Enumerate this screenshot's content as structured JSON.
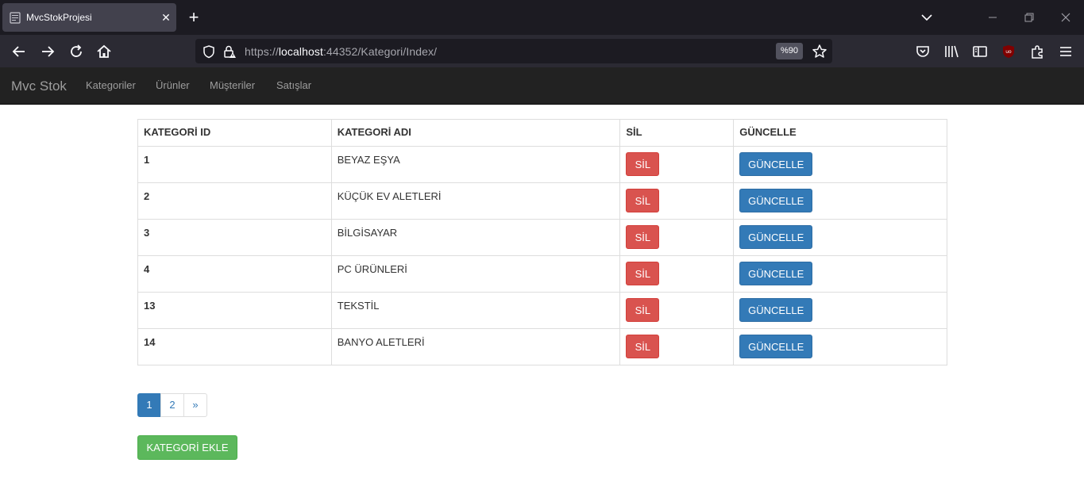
{
  "browser": {
    "tab_title": "MvcStokProjesi",
    "tab_close": "✕",
    "new_tab": "+",
    "url_prefix": "https://",
    "url_host": "localhost",
    "url_rest": ":44352/Kategori/Index/",
    "zoom": "%90",
    "icons": [
      "back-icon",
      "forward-icon",
      "reload-icon",
      "home-icon",
      "shield-icon",
      "lock-icon",
      "star-icon",
      "pocket-icon",
      "library-icon",
      "sidebar-icon",
      "ublock-icon",
      "extensions-icon",
      "menu-icon"
    ]
  },
  "site_nav": {
    "brand": "Mvc Stok",
    "links": [
      "Kategoriler",
      "Ürünler",
      "Müşteriler",
      "Satışlar"
    ]
  },
  "table": {
    "headers": [
      "KATEGORİ ID",
      "KATEGORİ ADI",
      "SİL",
      "GÜNCELLE"
    ],
    "rows": [
      {
        "id": "1",
        "name": "BEYAZ EŞYA"
      },
      {
        "id": "2",
        "name": "KÜÇÜK EV ALETLERİ"
      },
      {
        "id": "3",
        "name": "BİLGİSAYAR"
      },
      {
        "id": "4",
        "name": "PC ÜRÜNLERİ"
      },
      {
        "id": "13",
        "name": "TEKSTİL"
      },
      {
        "id": "14",
        "name": "BANYO ALETLERİ"
      }
    ],
    "delete_label": "SİL",
    "update_label": "GÜNCELLE"
  },
  "pagination": {
    "pages": [
      "1",
      "2",
      "»"
    ],
    "active": "1"
  },
  "add_button": "KATEGORİ EKLE",
  "colors": {
    "navbar": "#222222",
    "danger": "#d9534f",
    "primary": "#337ab7",
    "success": "#5cb85c"
  }
}
